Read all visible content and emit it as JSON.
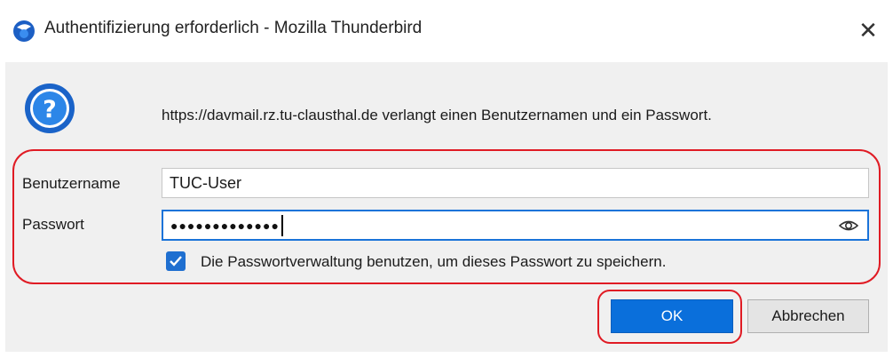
{
  "window": {
    "title": "Authentifizierung erforderlich - Mozilla Thunderbird",
    "close_glyph": "✕",
    "app_icon": "thunderbird-icon"
  },
  "dialog": {
    "icon": "question-icon",
    "message": "https://davmail.rz.tu-clausthal.de verlangt einen Benutzernamen und ein Passwort.",
    "username_label": "Benutzername",
    "username_value": "TUC-User",
    "password_label": "Passwort",
    "password_value": "●●●●●●●●●●●●●",
    "password_toggle_icon": "eye-icon",
    "remember_checked": true,
    "remember_label": "Die Passwortverwaltung benutzen, um dieses Passwort zu speichern."
  },
  "buttons": {
    "ok": "OK",
    "cancel": "Abbrechen"
  },
  "colors": {
    "accent": "#0a6fdb",
    "highlight_outline": "#e01b24",
    "dialog_bg": "#f0f0f0"
  }
}
